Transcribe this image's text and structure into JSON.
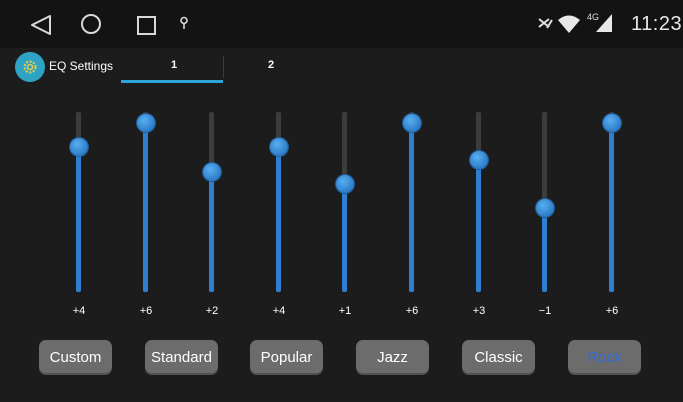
{
  "status": {
    "time": "11:23",
    "network_label": "4G"
  },
  "app": {
    "title": "EQ Settings",
    "tabs": [
      {
        "label": "1",
        "selected": true
      },
      {
        "label": "2",
        "selected": false
      }
    ]
  },
  "eq": {
    "min": -6,
    "max": 6,
    "bands": [
      {
        "value": 4,
        "label": "+4"
      },
      {
        "value": 6,
        "label": "+6"
      },
      {
        "value": 2,
        "label": "+2"
      },
      {
        "value": 4,
        "label": "+4"
      },
      {
        "value": 1,
        "label": "+1"
      },
      {
        "value": 6,
        "label": "+6"
      },
      {
        "value": 3,
        "label": "+3"
      },
      {
        "value": -1,
        "label": "−1"
      },
      {
        "value": 6,
        "label": "+6"
      }
    ]
  },
  "presets": [
    {
      "label": "Custom",
      "active": false
    },
    {
      "label": "Standard",
      "active": false
    },
    {
      "label": "Popular",
      "active": false
    },
    {
      "label": "Jazz",
      "active": false
    },
    {
      "label": "Classic",
      "active": false
    },
    {
      "label": "Rock",
      "active": true
    }
  ],
  "colors": {
    "accent": "#2e7fd2",
    "active_preset_text": "#2f6bd9",
    "app_icon_bg": "#2ea3c4",
    "background": "#1c1c1c"
  }
}
